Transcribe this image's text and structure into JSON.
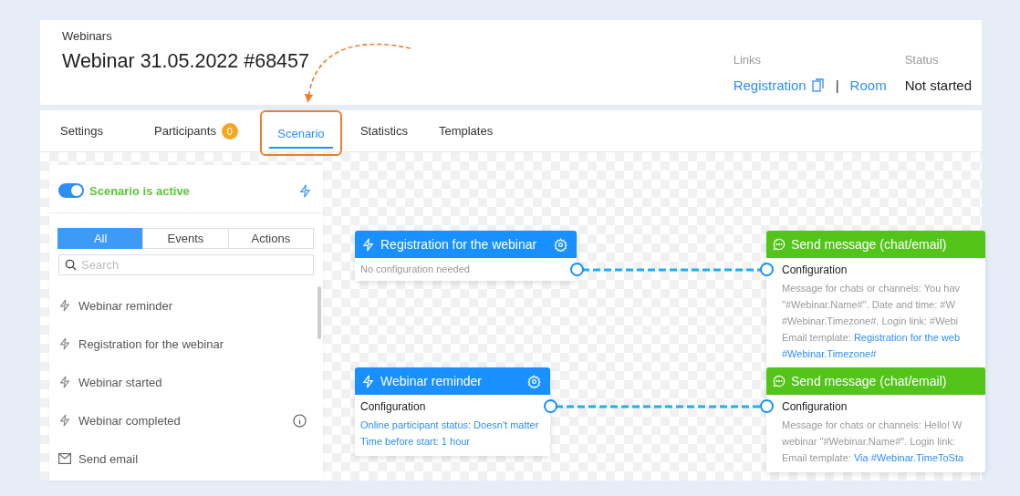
{
  "header": {
    "breadcrumb": "Webinars",
    "title": "Webinar 31.05.2022 #68457",
    "links_label": "Links",
    "links": [
      {
        "label": "Registration",
        "copy": true
      },
      {
        "label": "Room",
        "copy": false
      }
    ],
    "separator": "|",
    "status_label": "Status",
    "status": "Not started"
  },
  "tabs": [
    {
      "label": "Settings",
      "selected": false,
      "highlighted": false
    },
    {
      "label": "Participants",
      "selected": false,
      "highlighted": false,
      "badge": "0"
    },
    {
      "label": "Scenario",
      "selected": true,
      "highlighted": true
    },
    {
      "label": "Statistics",
      "selected": false,
      "highlighted": false
    },
    {
      "label": "Templates",
      "selected": false,
      "highlighted": false
    }
  ],
  "sidebar": {
    "toggle": {
      "label": "Scenario is active",
      "on": true
    },
    "filters": [
      {
        "label": "All",
        "selected": true
      },
      {
        "label": "Events",
        "selected": false
      },
      {
        "label": "Actions",
        "selected": false
      }
    ],
    "search": {
      "placeholder": "Search"
    },
    "items": [
      {
        "label": "Webinar reminder",
        "kind": "event",
        "info": false
      },
      {
        "label": "Registration for the webinar",
        "kind": "event",
        "info": false
      },
      {
        "label": "Webinar started",
        "kind": "event",
        "info": false
      },
      {
        "label": "Webinar completed",
        "kind": "event",
        "info": true
      },
      {
        "label": "Send email",
        "kind": "email",
        "info": false
      }
    ]
  },
  "nodes": [
    {
      "kind": "event",
      "title": "Registration for the webinar",
      "note": "No configuration needed"
    },
    {
      "kind": "event",
      "title": "Webinar reminder",
      "config_title": "Configuration",
      "lines": [
        {
          "link": "Online participant status: Doesn't matter"
        },
        {
          "link": "Time before start: 1 hour"
        }
      ]
    },
    {
      "kind": "action",
      "title": "Send message (chat/email)",
      "config_title": "Configuration",
      "lines": [
        {
          "text": "Message for chats or channels: You hav"
        },
        {
          "text": "\"#Webinar.Name#\". Date and time: #W"
        },
        {
          "text": "#Webinar.Timezone#. Login link: #Webi"
        },
        {
          "text": "Email template: ",
          "link": "Registration for the web"
        },
        {
          "link": "#Webinar.Timezone#"
        }
      ]
    },
    {
      "kind": "action",
      "title": "Send message (chat/email)",
      "config_title": "Configuration",
      "lines": [
        {
          "text": "Message for chats or channels: Hello! W"
        },
        {
          "text": "webinar \"#Webinar.Name#\". Login link:"
        },
        {
          "text": "Email template: ",
          "link": "Via #Webinar.TimeToSta"
        }
      ]
    }
  ]
}
